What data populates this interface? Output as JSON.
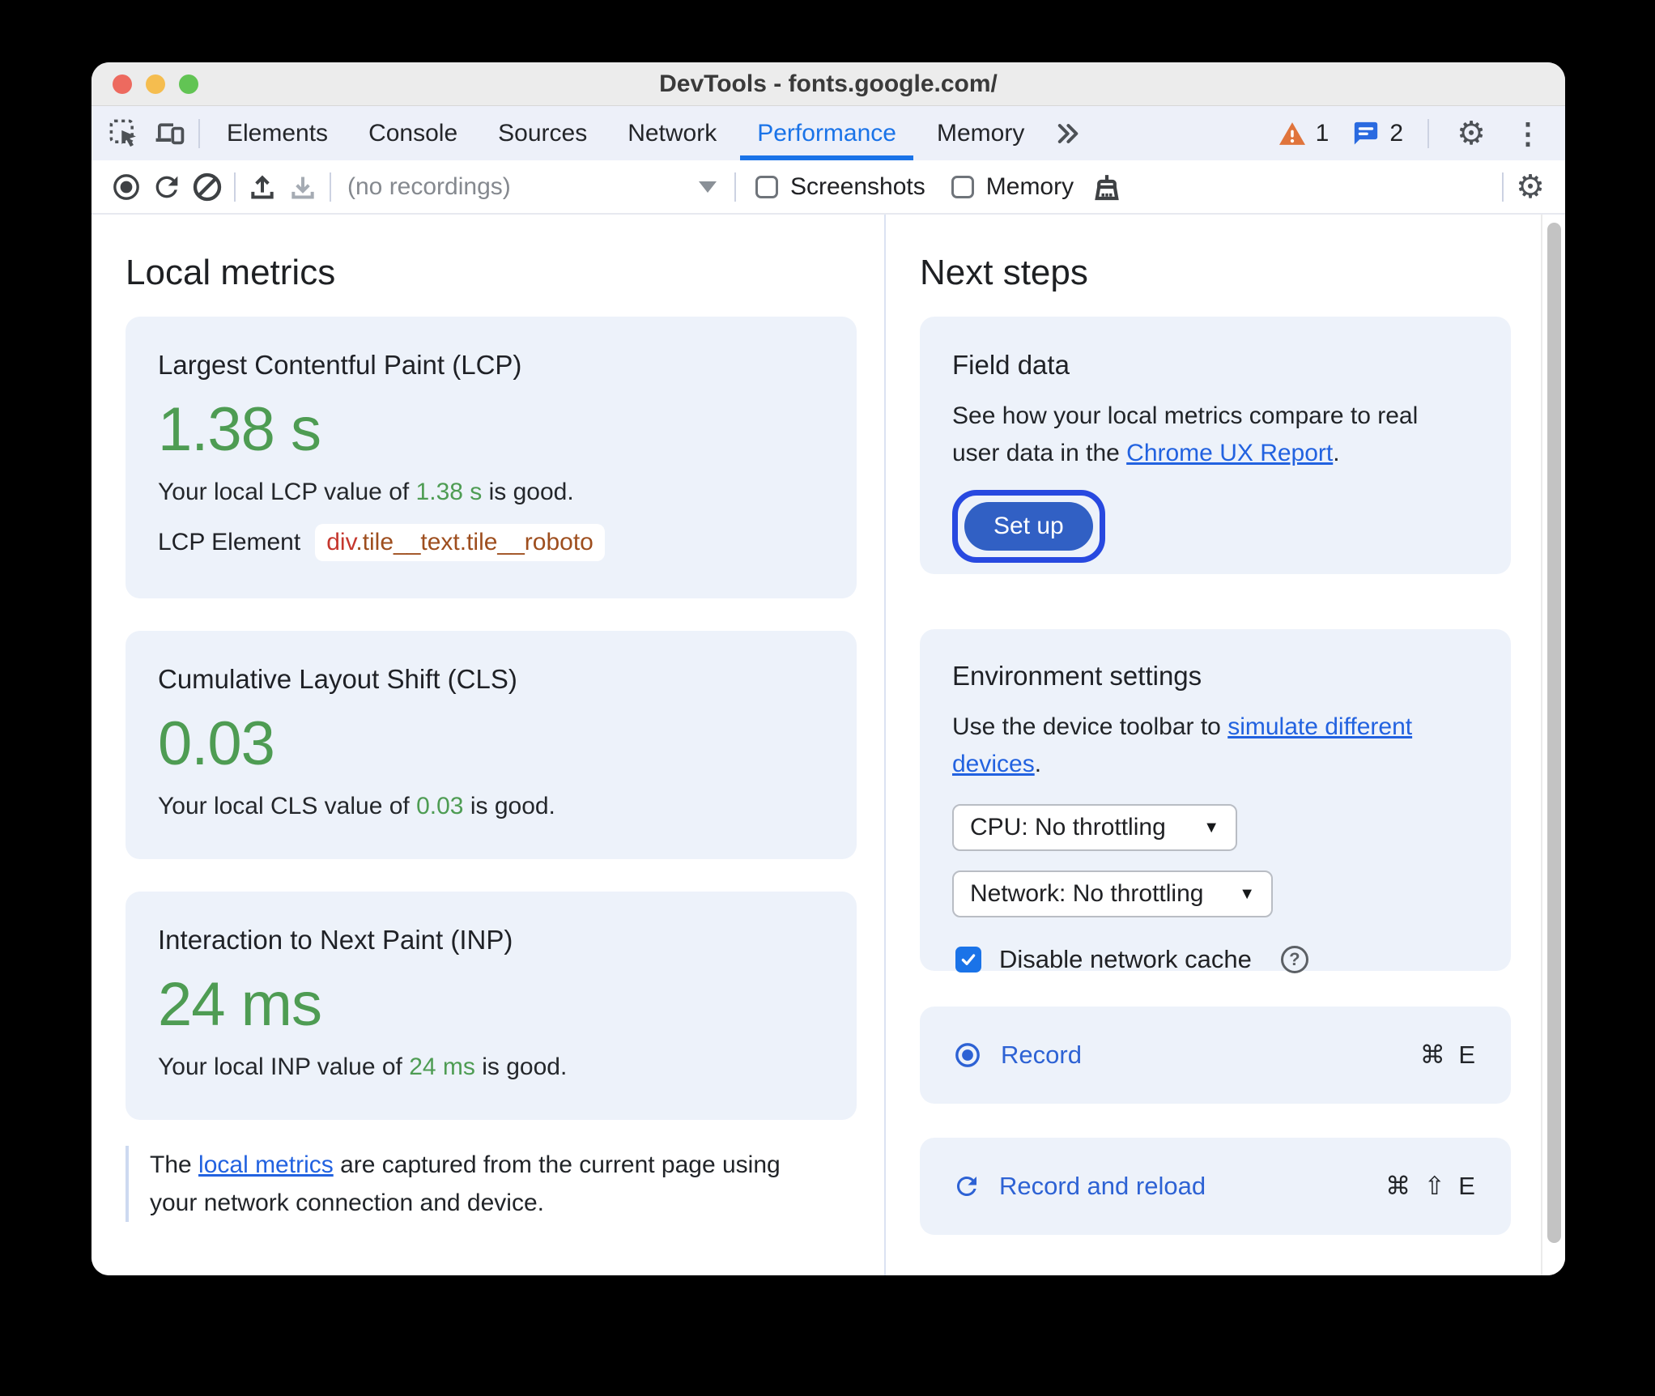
{
  "window": {
    "title": "DevTools - fonts.google.com/"
  },
  "tab_bar": {
    "tabs": [
      "Elements",
      "Console",
      "Sources",
      "Network",
      "Performance",
      "Memory"
    ],
    "active_tab": "Performance",
    "warning_count": "1",
    "issues_count": "2"
  },
  "toolbar": {
    "recordings_select": "(no recordings)",
    "screenshots_label": "Screenshots",
    "memory_label": "Memory"
  },
  "local_metrics": {
    "heading": "Local metrics",
    "lcp": {
      "title": "Largest Contentful Paint (LCP)",
      "value": "1.38 s",
      "desc_prefix": "Your local LCP value of ",
      "desc_value": "1.38 s",
      "desc_suffix": " is good.",
      "element_label": "LCP Element",
      "element_tag": "div",
      "element_classes": ".tile__text.tile__roboto"
    },
    "cls": {
      "title": "Cumulative Layout Shift (CLS)",
      "value": "0.03",
      "desc_prefix": "Your local CLS value of ",
      "desc_value": "0.03",
      "desc_suffix": " is good."
    },
    "inp": {
      "title": "Interaction to Next Paint (INP)",
      "value": "24 ms",
      "desc_prefix": "Your local INP value of ",
      "desc_value": "24 ms",
      "desc_suffix": " is good."
    },
    "footer": {
      "prefix": "The ",
      "link": "local metrics",
      "line1_rest": " are captured from the current page using",
      "line2": "your network connection and device."
    }
  },
  "next_steps": {
    "heading": "Next steps",
    "field_data": {
      "title": "Field data",
      "line1": "See how your local metrics compare to real",
      "line2_prefix": "user data in the ",
      "line2_link": "Chrome UX Report",
      "line2_suffix": ".",
      "button_label": "Set up"
    },
    "environment": {
      "title": "Environment settings",
      "line1_prefix": "Use the device toolbar to ",
      "line1_link": "simulate different",
      "line2_link": "devices",
      "line2_suffix": ".",
      "cpu_select": "CPU: No throttling",
      "network_select": "Network: No throttling",
      "cache_label": "Disable network cache"
    },
    "record": {
      "label": "Record",
      "shortcut": "⌘ E"
    },
    "record_reload": {
      "label": "Record and reload",
      "shortcut": "⌘ ⇧ E"
    }
  },
  "glyphs": {
    "gear": "⚙",
    "more": "⋮",
    "caret_down": "▼",
    "help": "?"
  },
  "colors": {
    "good_green": "#4e9c53",
    "accent_blue": "#1a73e8",
    "link_blue": "#2262e0",
    "primary_button_blue": "#3160c4",
    "focus_ring_blue": "#2849e0",
    "record_blue": "#2d62d4",
    "warning_orange": "#e0743c",
    "code_tag_red": "#c5372e",
    "code_class_brown": "#9e4e1e",
    "card_background": "#edf2fa"
  }
}
